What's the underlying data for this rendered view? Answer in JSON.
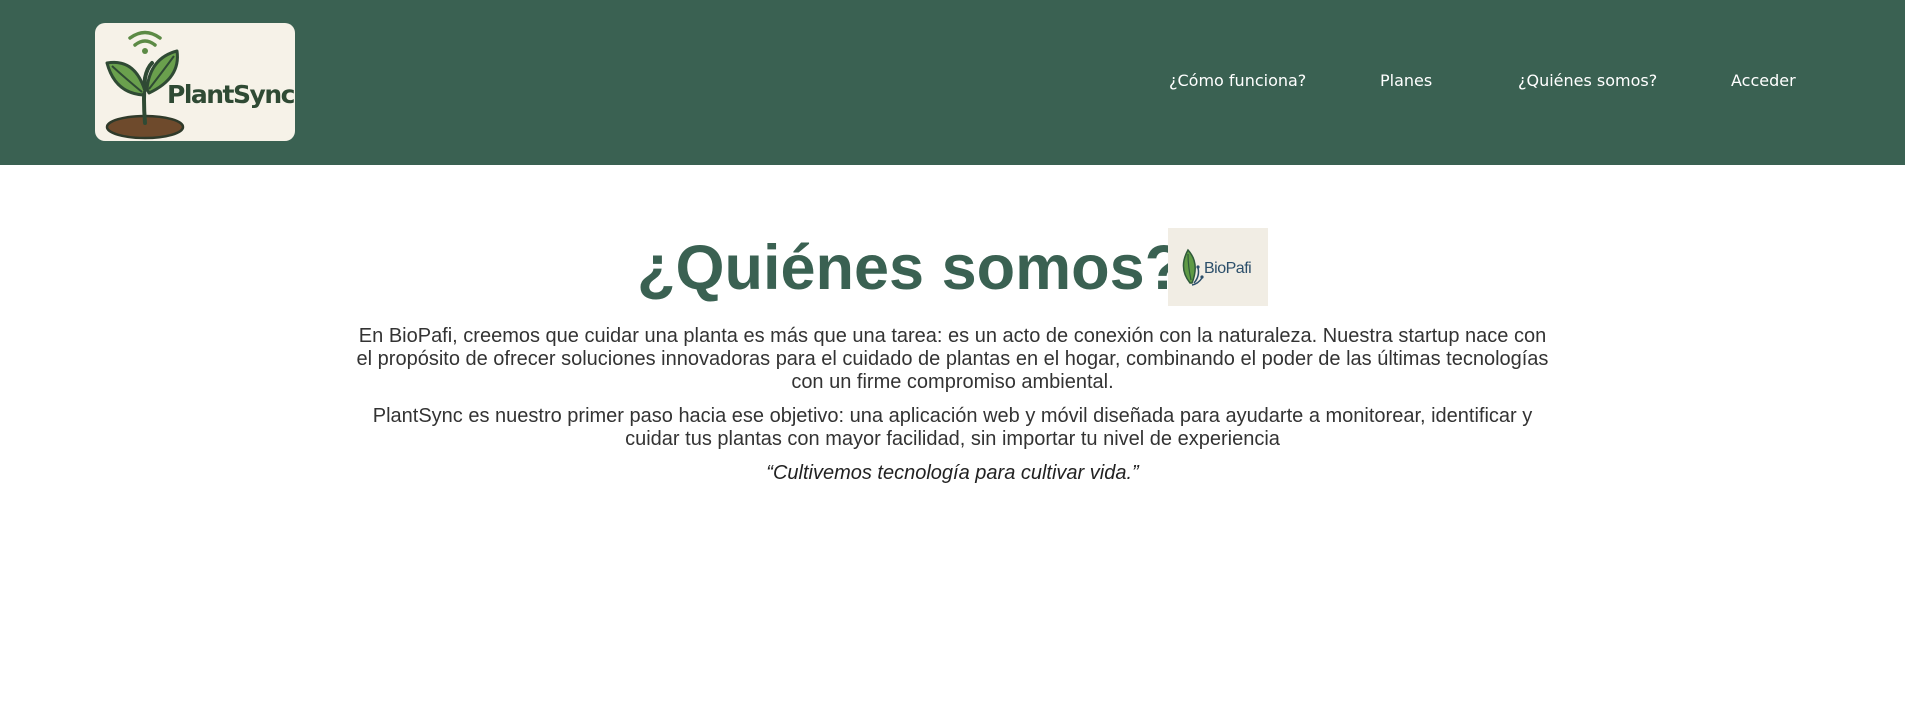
{
  "header": {
    "logo_text": "PlantSync",
    "nav": [
      {
        "label": "¿Cómo funciona?"
      },
      {
        "label": "Planes"
      },
      {
        "label": "¿Quiénes somos?"
      },
      {
        "label": "Acceder"
      }
    ],
    "background_color": "#3a6152"
  },
  "main": {
    "title": "¿Quiénes somos?",
    "partner_logo_text": "BioPafi",
    "paragraphs": [
      "En BioPafi, creemos que cuidar una planta es más que una tarea: es un acto de conexión con la naturaleza. Nuestra startup nace con el propósito de ofrecer soluciones innovadoras para el cuidado de plantas en el hogar, combinando el poder de las últimas tecnologías con un firme compromiso ambiental.",
      "PlantSync es nuestro primer paso hacia ese objetivo: una aplicación web y móvil diseñada para ayudarte a monitorear, identificar y cuidar tus plantas con mayor facilidad, sin importar tu nivel de experiencia"
    ],
    "quote": "“Cultivemos tecnología para cultivar vida.”",
    "title_color": "#3a6152"
  },
  "icons": {
    "logo": "plant-sprout-wifi-icon",
    "partner_logo": "leaf-circuit-icon"
  }
}
